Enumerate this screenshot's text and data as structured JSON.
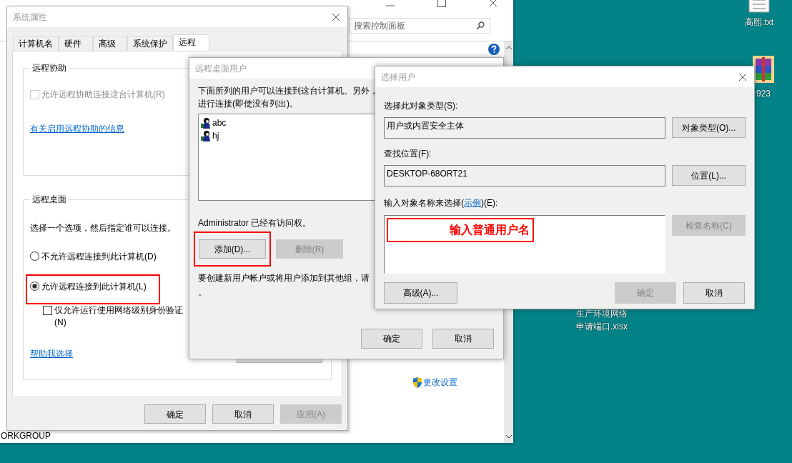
{
  "desktop": {
    "icons": [
      {
        "kind": "text-file",
        "label": "高熙.txt"
      },
      {
        "kind": "archive",
        "label": "923"
      },
      {
        "kind": "spreadsheet",
        "label_lines": [
          "生产环境网络",
          "申请端口.xlsx"
        ]
      }
    ]
  },
  "control_panel": {
    "search": {
      "placeholder": "搜索控制面板"
    },
    "change_settings_link": "更改设置",
    "workgroup": "ORKGROUP"
  },
  "system_properties": {
    "title": "系统属性",
    "tabs": [
      {
        "label": "计算机名",
        "selected": false
      },
      {
        "label": "硬件",
        "selected": false
      },
      {
        "label": "高级",
        "selected": false
      },
      {
        "label": "系统保护",
        "selected": false
      },
      {
        "label": "远程",
        "selected": true
      }
    ],
    "remote_assistance": {
      "title": "远程协助",
      "checkbox": {
        "label": "允许远程协助连接这台计算机(R)",
        "checked": false,
        "disabled": true
      },
      "link": "有关启用远程协助的信息"
    },
    "remote_desktop": {
      "title": "远程桌面",
      "instruction": "选择一个选项，然后指定谁可以连接。",
      "options": [
        {
          "label": "不允许远程连接到此计算机(D)",
          "selected": false,
          "highlighted": false
        },
        {
          "label": "允许远程连接到此计算机(L)",
          "selected": true,
          "highlighted": true
        }
      ],
      "nla_checkbox": {
        "label_lines": [
          "仅允许运行使用网络级别身份验证",
          "(N)"
        ],
        "checked": false
      },
      "help_link": "帮助我选择"
    },
    "buttons": [
      {
        "label": "确定",
        "disabled": false
      },
      {
        "label": "取消",
        "disabled": false
      },
      {
        "label": "应用(A)",
        "disabled": true
      }
    ]
  },
  "remote_users": {
    "title": "远程桌面用户",
    "description_lines": [
      "下面所列的用户可以连接到这台计算机。另外，",
      "进行连接(即使没有列出)。"
    ],
    "users": [
      {
        "name": "abc"
      },
      {
        "name": "hj"
      }
    ],
    "admin_note": "Administrator 已经有访问权。",
    "list_buttons": [
      {
        "label": "添加(D)...",
        "disabled": false,
        "highlighted": true
      },
      {
        "label": "删除(R)",
        "disabled": true,
        "highlighted": false
      }
    ],
    "footer_lines": [
      "要创建新用户帐户或将用户添加到其他组，请",
      "。"
    ],
    "buttons": [
      {
        "label": "确定",
        "disabled": false
      },
      {
        "label": "取消",
        "disabled": false
      }
    ]
  },
  "select_user": {
    "title": "选择用户",
    "object_type": {
      "label": "选择此对象类型(S):",
      "value": "用户或内置安全主体",
      "button": "对象类型(O)..."
    },
    "location": {
      "label": "查找位置(F):",
      "value": "DESKTOP-68ORT21",
      "button": "位置(L)..."
    },
    "names": {
      "label_before": "输入对象名称来选择(",
      "label_link": "示例",
      "label_after": ")(E):",
      "annotation": "输入普通用户名",
      "check_button": {
        "label": "检查名称(C)",
        "disabled": true
      }
    },
    "advanced_button": "高级(A)...",
    "buttons": [
      {
        "label": "确定",
        "disabled": true
      },
      {
        "label": "取消",
        "disabled": false
      }
    ]
  }
}
